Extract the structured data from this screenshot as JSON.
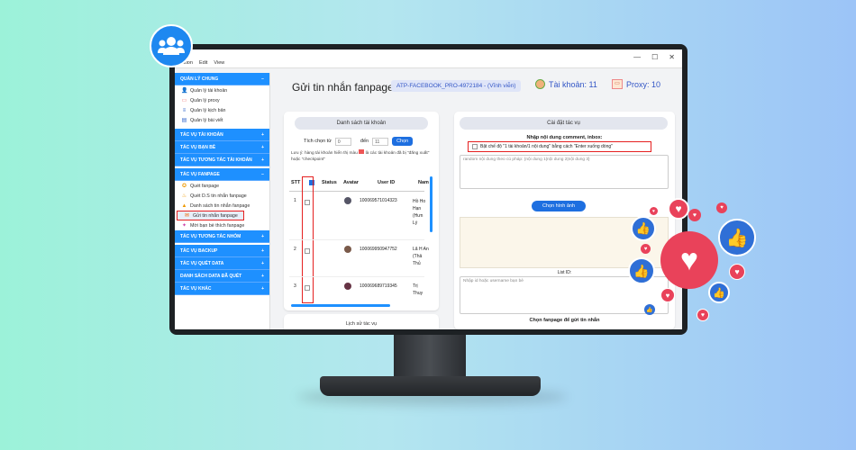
{
  "app": {
    "title": "",
    "menu": [
      "ation",
      "Edit",
      "View"
    ],
    "window_controls": [
      "—",
      "☐",
      "✕"
    ]
  },
  "header": {
    "page_title": "Gửi tin nhắn fanpage",
    "license_badge": "ATP-FACEBOOK_PRO-4972184 - (Vĩnh viễn)",
    "accounts_label": "Tài khoản: 11",
    "proxy_label": "Proxy: 10"
  },
  "sidebar": {
    "sections": [
      {
        "label": "QUẢN LÝ CHUNG",
        "toggle": "−",
        "items": [
          {
            "label": "Quản lý tài khoản",
            "icon": "user-icon"
          },
          {
            "label": "Quản lý proxy",
            "icon": "proxy-icon"
          },
          {
            "label": "Quản lý kịch bản",
            "icon": "script-icon"
          },
          {
            "label": "Quản lý bài viết",
            "icon": "post-icon"
          }
        ]
      },
      {
        "label": "TÁC VỤ TÀI KHOẢN",
        "toggle": "+",
        "items": []
      },
      {
        "label": "TÁC VỤ BẠN BÈ",
        "toggle": "+",
        "items": []
      },
      {
        "label": "TÁC VỤ TƯƠNG TÁC TÀI KHOẢN",
        "toggle": "+",
        "items": []
      },
      {
        "label": "TÁC VỤ FANPAGE",
        "toggle": "−",
        "items": [
          {
            "label": "Quét fanpage",
            "icon": "scan-icon"
          },
          {
            "label": "Quét D.S tin nhắn fanpage",
            "icon": "scan-message-icon"
          },
          {
            "label": "Danh sách tin nhắn fanpage",
            "icon": "message-list-icon"
          },
          {
            "label": "Gửi tin nhắn fanpage",
            "icon": "send-message-icon",
            "active": true
          },
          {
            "label": "Mời bạn bè thích fanpage",
            "icon": "invite-icon"
          }
        ]
      },
      {
        "label": "TÁC VỤ TƯƠNG TÁC NHÓM",
        "toggle": "+",
        "items": []
      },
      {
        "label": "TÁC VỤ BACKUP",
        "toggle": "+",
        "items": []
      },
      {
        "label": "TÁC VỤ QUÉT DATA",
        "toggle": "+",
        "items": []
      },
      {
        "label": "DANH SÁCH DATA ĐÃ QUÉT",
        "toggle": "+",
        "items": []
      },
      {
        "label": "TÁC VỤ KHÁC",
        "toggle": "+",
        "items": []
      }
    ]
  },
  "accounts_panel": {
    "title": "Danh sách tài khoản",
    "select_from_label": "Tích chọn từ",
    "select_from_value": "0",
    "select_to_label": "đến",
    "select_to_value": "11",
    "select_button": "Chọn",
    "note_prefix": "Lưu ý: hàng tài khoản hiển thị màu",
    "note_suffix": "là các tài khoản đã bị \"đăng xuất\" hoặc \"checkpoint\"",
    "columns": [
      "STT",
      "",
      "Status",
      "Avatar",
      "User ID",
      "Nam"
    ],
    "rows": [
      {
        "stt": "1",
        "user_id": "100069571014323",
        "name": "Hồ Ho Hạn (Hưn Lý"
      },
      {
        "stt": "2",
        "user_id": "100069950947752",
        "name": "Lã H An (Thả Thủ"
      },
      {
        "stt": "3",
        "user_id": "100069689719345",
        "name": "Trị Thuy"
      }
    ],
    "history_title": "Lịch sử tác vụ"
  },
  "task_panel": {
    "title": "Cài đặt tác vụ",
    "content_label": "Nhập nội dung comment, inbox:",
    "multiline_option": "Bật chế độ \"1 tài khoản/1 nội dung\" bằng cách \"Enter xuống dòng\"",
    "content_placeholder": "random nội dung theo cú pháp: {nội dung 1|nội dung 2|nội dung 3}",
    "choose_image_button": "Chọn hình ảnh",
    "list_id_label": "List ID:",
    "list_id_placeholder": "Nhập id hoặc username bạn bè",
    "fanpage_select_label": "Chọn fanpage để gửi tin nhắn"
  },
  "colors": {
    "accent": "#1e90ff",
    "highlight": "#e52020",
    "heart": "#e9425a",
    "like": "#2f6fd6"
  }
}
